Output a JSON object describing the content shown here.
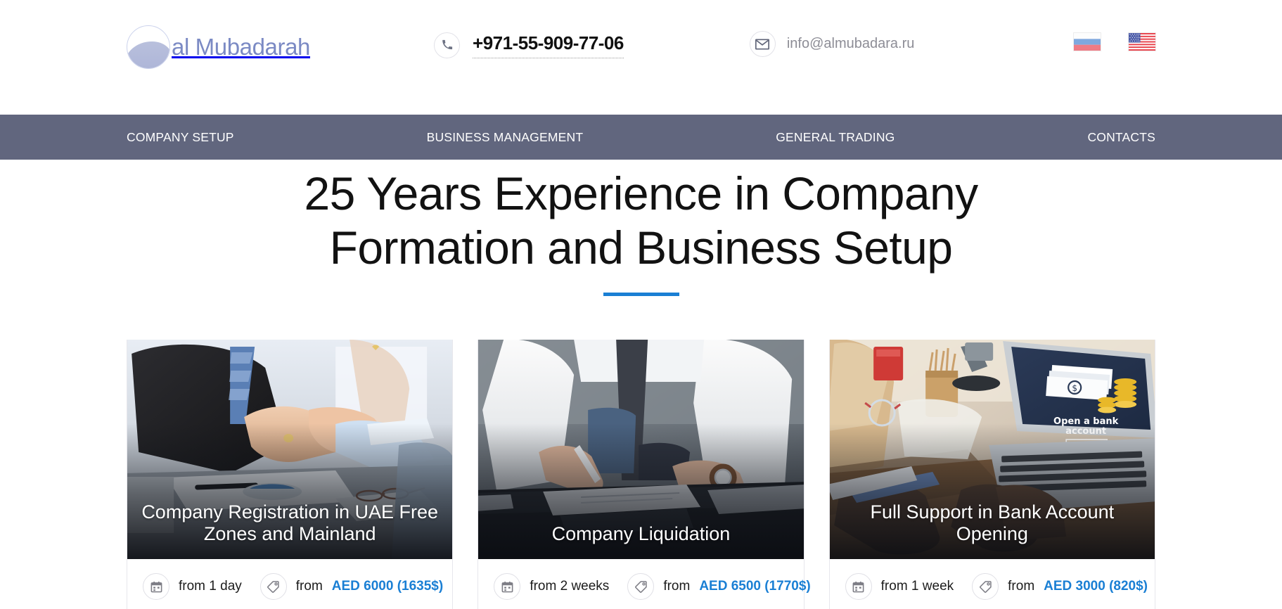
{
  "brand": {
    "logo_text": "al Mubadarah",
    "logo_icon": "circle-wave-logo-icon"
  },
  "header": {
    "phone_icon": "phone-icon",
    "phone": "+971-55-909-77-06",
    "email_icon": "envelope-icon",
    "email": "info@almubadara.ru",
    "languages": [
      {
        "name": "russian-flag-icon",
        "label": "RU"
      },
      {
        "name": "us-flag-icon",
        "label": "EN"
      }
    ]
  },
  "nav": {
    "items": [
      {
        "label": "COMPANY SETUP"
      },
      {
        "label": "BUSINESS MANAGEMENT"
      },
      {
        "label": "GENERAL TRADING"
      },
      {
        "label": "CONTACTS"
      }
    ]
  },
  "hero": {
    "title": "25 Years Experience in Company Formation and Business Setup",
    "accent_color": "#1a7fd4"
  },
  "cards": [
    {
      "title": "Company Registration in UAE Free Zones and Mainland",
      "image_alt": "businessman-handshake-photo",
      "duration_icon": "calendar-icon",
      "duration": "from 1 day",
      "price_icon": "price-tag-icon",
      "price_prefix": "from ",
      "price": "AED 6000 (1635$)"
    },
    {
      "title": "Company Liquidation",
      "image_alt": "man-signing-document-photo",
      "duration_icon": "calendar-icon",
      "duration": "from 2 weeks",
      "price_icon": "price-tag-icon",
      "price_prefix": "from ",
      "price": "AED 6500 (1770$)"
    },
    {
      "title": "Full Support in Bank Account Opening",
      "image_alt": "laptop-open-bank-account-photo",
      "duration_icon": "calendar-icon",
      "duration": "from 1 week",
      "price_icon": "price-tag-icon",
      "price_prefix": "from ",
      "price": "AED 3000 (820$)"
    }
  ],
  "colors": {
    "nav_bg": "#61667e",
    "accent": "#1a7fd4",
    "logo_text": "#7b8ac4",
    "email_text": "#8d8d96"
  }
}
